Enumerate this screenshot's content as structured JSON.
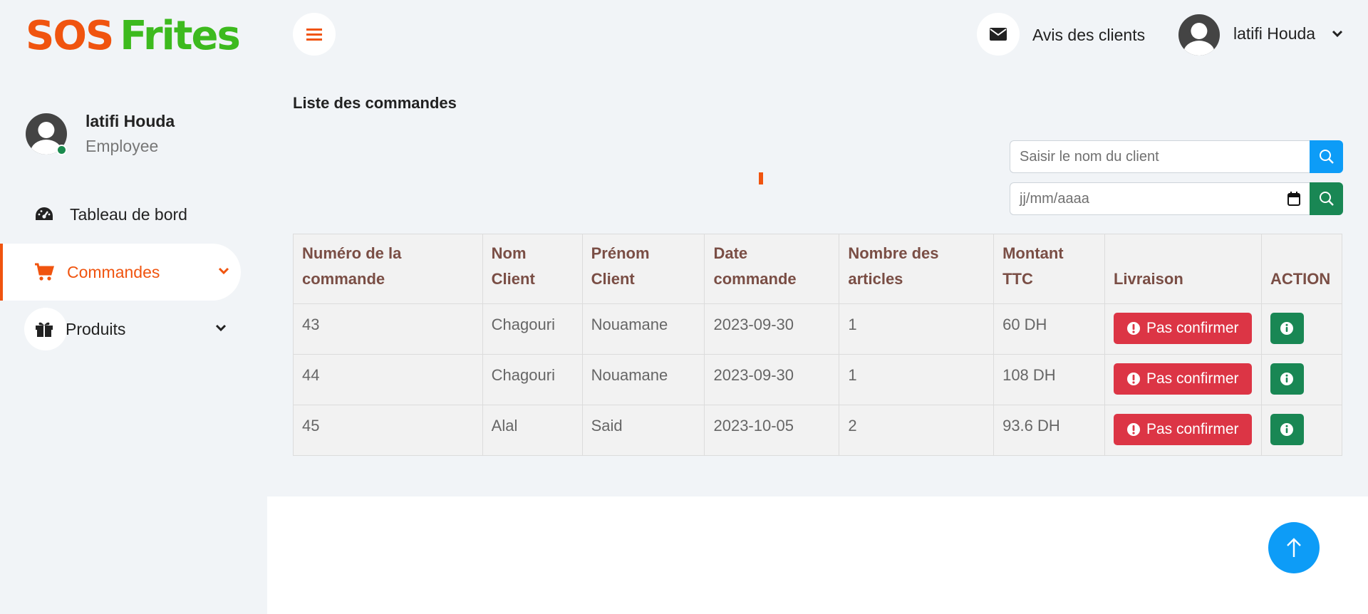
{
  "brand": {
    "part1": "SOS",
    "part2": "Frites",
    "color1": "#f0540f",
    "color2": "#3dba1e"
  },
  "profile": {
    "name": "latifi Houda",
    "role": "Employee",
    "status": "online"
  },
  "sidebar": {
    "items": [
      {
        "label": "Tableau de bord",
        "icon": "dashboard-gauge-icon",
        "active": false
      },
      {
        "label": "Commandes",
        "icon": "cart-icon",
        "active": true,
        "expandable": true
      },
      {
        "label": "Produits",
        "icon": "gift-icon",
        "active": false,
        "expandable": true
      }
    ]
  },
  "topbar": {
    "menu_icon": "hamburger-icon",
    "reviews_icon": "envelope-icon",
    "reviews_label": "Avis des clients",
    "user_name": "latifi Houda"
  },
  "main": {
    "title": "Liste des commandes",
    "search": {
      "placeholder": "Saisir le nom du client"
    },
    "date_filter": {
      "placeholder": "jj/mm/aaaa"
    }
  },
  "table": {
    "headers": [
      "Numéro de la commande",
      "Nom Client",
      "Prénom Client",
      "Date commande",
      "Nombre des articles",
      "Montant TTC",
      "Livraison",
      "ACTION"
    ],
    "rows": [
      {
        "numero": "43",
        "nom": "Chagouri",
        "prenom": "Nouamane",
        "date": "2023-09-30",
        "articles": "1",
        "montant": "60 DH",
        "livraison": "Pas confirmer"
      },
      {
        "numero": "44",
        "nom": "Chagouri",
        "prenom": "Nouamane",
        "date": "2023-09-30",
        "articles": "1",
        "montant": "108 DH",
        "livraison": "Pas confirmer"
      },
      {
        "numero": "45",
        "nom": "Alal",
        "prenom": "Said",
        "date": "2023-10-05",
        "articles": "2",
        "montant": "93.6 DH",
        "livraison": "Pas confirmer"
      }
    ]
  },
  "colors": {
    "accent": "#f0540f",
    "danger": "#dc3545",
    "success": "#198754",
    "primary": "#0d9cf7",
    "header_text": "#7a4e45"
  }
}
